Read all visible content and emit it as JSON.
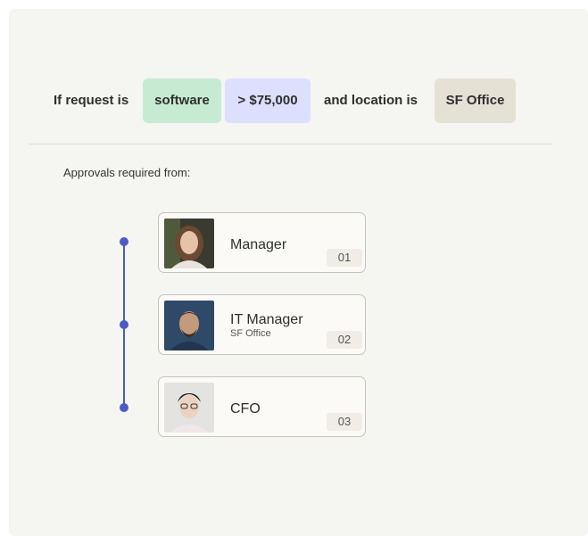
{
  "rule": {
    "if_label": "If request is",
    "category_chip": {
      "text": "software",
      "bg": "#c6ebd2"
    },
    "amount_chip": {
      "text": "> $75,000",
      "bg": "#dcdffd"
    },
    "and_label": "and  location is",
    "location_chip": {
      "text": "SF Office",
      "bg": "#e5e1d5"
    }
  },
  "approvals": {
    "label": "Approvals required from:",
    "steps": [
      {
        "role": "Manager",
        "subtitle": "",
        "number": "01"
      },
      {
        "role": "IT Manager",
        "subtitle": "SF Office",
        "number": "02"
      },
      {
        "role": "CFO",
        "subtitle": "",
        "number": "03"
      }
    ]
  },
  "colors": {
    "accent": "#4c5bc4",
    "panel_bg": "#f5f5f2",
    "card_bg": "#fbfaf6"
  }
}
